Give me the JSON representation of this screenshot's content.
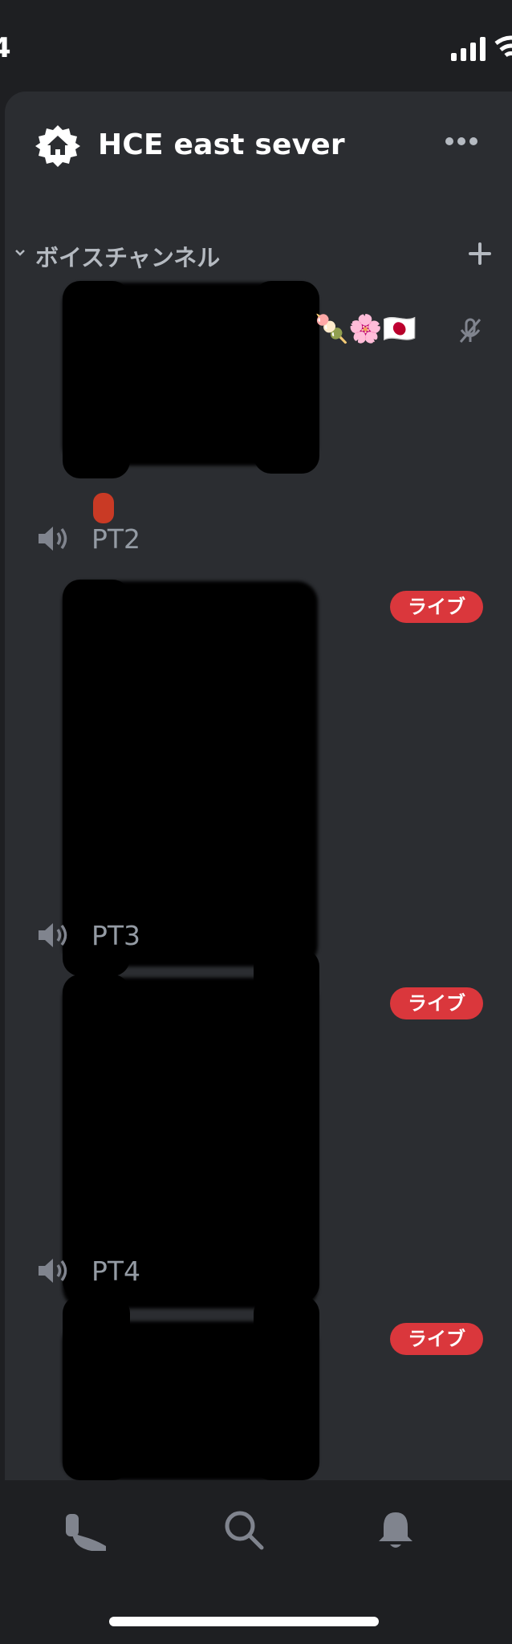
{
  "status_bar": {
    "time": "4"
  },
  "server": {
    "name": "HCE east sever",
    "icon": "home-icon"
  },
  "category": {
    "label": "ボイスチャンネル"
  },
  "first_user": {
    "emojis": "🍡🌸🇯🇵",
    "status_icon": "mute-icon"
  },
  "channels": [
    {
      "name": "PT2",
      "badge": "ライブ"
    },
    {
      "name": "PT3",
      "badge": "ライブ"
    },
    {
      "name": "PT4",
      "badge": "ライブ"
    }
  ],
  "nav": {
    "items": [
      "voice-home-icon",
      "search-icon",
      "bell-icon"
    ]
  },
  "colors": {
    "background": "#1e1f22",
    "panel": "#2b2d31",
    "live_badge": "#da373c",
    "muted_text": "#949ba4"
  }
}
